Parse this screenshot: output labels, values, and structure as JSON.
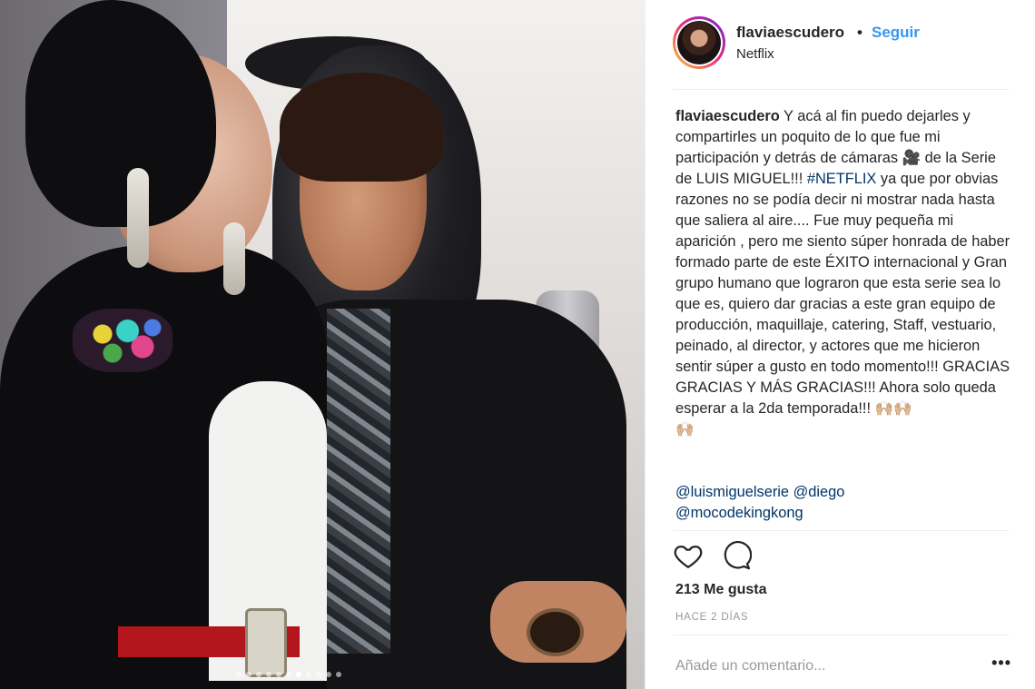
{
  "post": {
    "username": "flaviaescudero",
    "separator": "•",
    "follow_label": "Seguir",
    "location": "Netflix",
    "caption_user": "flaviaescudero",
    "caption_part1": " Y acá al fin puedo dejarles y compartirles un poquito de lo que fue mi participación y detrás de cámaras 🎥 de la Serie de LUIS MIGUEL!!! ",
    "caption_hashtag": "#NETFLIX",
    "caption_part2": " ya que por obvias razones no se podía decir ni mostrar nada hasta que saliera al aire.... Fue muy pequeña mi aparición , pero me siento súper honrada de haber formado parte de este ÉXITO internacional y Gran grupo humano que lograron que esta serie sea lo que es, quiero dar gracias a este gran equipo de producción, maquillaje, catering, Staff, vestuario, peinado, al director, y actores que me hicieron sentir súper a gusto en todo momento!!! GRACIAS GRACIAS Y MÁS GRACIAS!!! Ahora solo queda esperar a la 2da temporada!!! 🙌🏼🙌🏼",
    "caption_tail": "🙌🏼",
    "mentions": [
      "@luismiguelserie @diego",
      "@mocodekingkong"
    ],
    "likes": "213 Me gusta",
    "time": "HACE 2 DÍAS",
    "comment_placeholder": "Añade un comentario...",
    "more_label": "•••"
  },
  "carousel": {
    "count": 11,
    "active_index": 6
  },
  "icons": {
    "like": "heart-outline-icon",
    "comment": "speech-bubble-icon",
    "more": "ellipsis-icon"
  },
  "colors": {
    "link": "#3897f0",
    "mention": "#003569",
    "text": "#262626",
    "muted": "#999999"
  }
}
